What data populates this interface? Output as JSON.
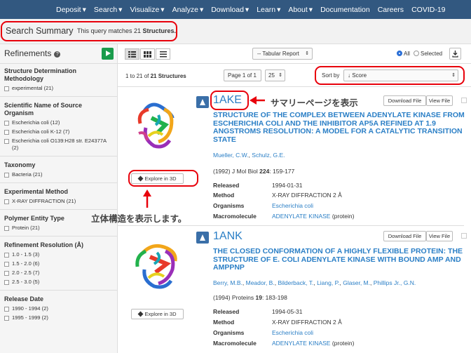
{
  "nav": [
    "Deposit",
    "Search",
    "Visualize",
    "Analyze",
    "Download",
    "Learn",
    "About",
    "Documentation",
    "Careers",
    "COVID-19"
  ],
  "nav_caret": "▾",
  "summary": {
    "title": "Search Summary",
    "text_prefix": "This query matches 21 ",
    "text_bold": "Structures."
  },
  "refinements": {
    "title": "Refinements",
    "help": "?",
    "facets": [
      {
        "title": "Structure Determination Methodology",
        "options": [
          "experimental (21)"
        ]
      },
      {
        "title": "Scientific Name of Source Organism",
        "options": [
          "Escherichia coli (12)",
          "Escherichia coli K-12 (7)",
          "Escherichia coli O139:H28 str. E24377A (2)"
        ]
      },
      {
        "title": "Taxonomy",
        "options": [
          "Bacteria (21)"
        ]
      },
      {
        "title": "Experimental Method",
        "options": [
          "X-RAY DIFFRACTION (21)"
        ]
      },
      {
        "title": "Polymer Entity Type",
        "options": [
          "Protein (21)"
        ]
      },
      {
        "title": "Refinement Resolution (Å)",
        "options": [
          "1.0 - 1.5 (3)",
          "1.5 - 2.0 (6)",
          "2.0 - 2.5 (7)",
          "2.5 - 3.0 (5)"
        ]
      },
      {
        "title": "Release Date",
        "options": [
          "1990 - 1994 (2)",
          "1995 - 1999 (2)"
        ]
      }
    ]
  },
  "toolbar": {
    "report": "-- Tabular Report",
    "report_arrow": "⇕",
    "all": "All",
    "selected": "Selected"
  },
  "paging": {
    "count_prefix": "1 to 21 of ",
    "count_bold": "21 Structures",
    "page": "Page 1 of 1",
    "per_page": "25",
    "arrow": "⇕",
    "sort_label": "Sort by",
    "sort_value": "↓ Score"
  },
  "results": [
    {
      "id": "1AKE",
      "title": "STRUCTURE OF THE COMPLEX BETWEEN ADENYLATE KINASE FROM ESCHERICHIA COLI AND THE INHIBITOR AP5A REFINED AT 1.9 ANGSTROMS RESOLUTION: A MODEL FOR A CATALYTIC TRANSITION STATE",
      "authors": [
        "Mueller, C.W.",
        "Schulz, G.E."
      ],
      "citation_pre": "(1992) J Mol Biol ",
      "citation_vol": "224",
      "citation_post": ": 159-177",
      "released": "1994-01-31",
      "method": "X-RAY DIFFRACTION 2 Å",
      "organisms": "Escherichia coli",
      "macromolecule": "ADENYLATE KINASE",
      "macromolecule_type": " (protein)"
    },
    {
      "id": "1ANK",
      "title": "THE CLOSED CONFORMATION OF A HIGHLY FLEXIBLE PROTEIN: THE STRUCTURE OF E. COLI ADENYLATE KINASE WITH BOUND AMP AND AMPPNP",
      "authors": [
        "Berry, M.B.",
        "Meador, B.",
        "Bilderback, T.",
        "Liang, P.",
        "Glaser, M.",
        "Phillips Jr., G.N."
      ],
      "citation_pre": "(1994) Proteins ",
      "citation_vol": "19",
      "citation_post": ": 183-198",
      "released": "1994-05-31",
      "method": "X-RAY DIFFRACTION 2 Å",
      "organisms": "Escherichia coli",
      "macromolecule": "ADENYLATE KINASE",
      "macromolecule_type": " (protein)"
    }
  ],
  "labels": {
    "released": "Released",
    "method": "Method",
    "organisms": "Organisms",
    "macromolecule": "Macromolecule",
    "explore": "Explore in 3D",
    "download": "Download File",
    "view": "View File"
  },
  "annotations": {
    "summary_page": "サマリーページを表示",
    "structure_3d": "立体構造を表示します。"
  },
  "colors": {
    "nav": "#325880",
    "link": "#2b7fc6",
    "highlight": "#e8000b",
    "go": "#1a9c4c"
  }
}
